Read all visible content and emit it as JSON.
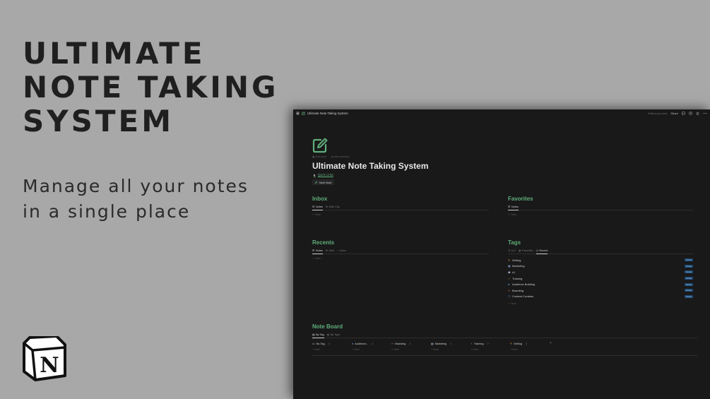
{
  "hero": {
    "title_lines": [
      "ULTIMATE",
      "NOTE TAKING",
      "SYSTEM"
    ],
    "subtitle_lines": [
      "Manage all your notes",
      "in a single place"
    ]
  },
  "logo": {
    "letter": "N"
  },
  "topbar": {
    "breadcrumb": "Ultimate Note Taking System",
    "edited": "Edited just now",
    "share": "Share"
  },
  "page": {
    "add_cover": "Add cover",
    "add_comment": "Add comment",
    "title": "Ultimate Note Taking System",
    "quick_links": "Quick Links",
    "new_note": "New Note"
  },
  "inbox": {
    "title": "Inbox",
    "tabs": [
      "Notes",
      "Web Clip"
    ],
    "new": "New"
  },
  "favorites": {
    "title": "Favorites",
    "tabs": [
      "Notes"
    ],
    "new": "New"
  },
  "recents": {
    "title": "Recents",
    "tabs": [
      "Notes",
      "Web",
      "Voice"
    ],
    "new": "New"
  },
  "tags": {
    "title": "Tags",
    "tabs": [
      "A-Z",
      "Favorites",
      "Recent"
    ],
    "items": [
      {
        "name": "Writing",
        "badge": "Notes"
      },
      {
        "name": "Marketing",
        "badge": "Notes"
      },
      {
        "name": "AI",
        "badge": "Notes"
      },
      {
        "name": "Training",
        "badge": "Notes"
      },
      {
        "name": "Audience Building",
        "badge": "Notes"
      },
      {
        "name": "Branding",
        "badge": "Notes"
      },
      {
        "name": "Content Creation",
        "badge": "Notes"
      }
    ],
    "new": "New"
  },
  "board": {
    "title": "Note Board",
    "tabs": [
      "By Tag",
      "By Type"
    ],
    "columns": [
      {
        "name": "No Tag",
        "count": "0",
        "new": "New"
      },
      {
        "name": "Audience...",
        "count": "0",
        "new": "New"
      },
      {
        "name": "Branding",
        "count": "0",
        "new": "New"
      },
      {
        "name": "Marketing",
        "count": "0",
        "new": "New"
      },
      {
        "name": "Training",
        "count": "0",
        "new": "New"
      },
      {
        "name": "Writing",
        "count": "0",
        "new": "New"
      }
    ],
    "add": "+"
  },
  "colors": {
    "accent_green": "#5fae7a",
    "badge_blue": "#1f4c78",
    "app_bg": "#191919",
    "backdrop": "#a8a8a8"
  }
}
